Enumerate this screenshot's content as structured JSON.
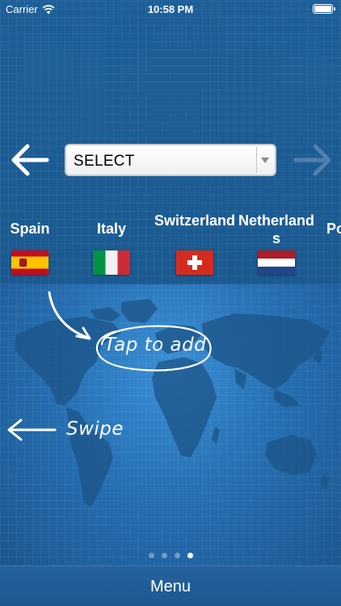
{
  "status_bar": {
    "carrier": "Carrier",
    "time": "10:58 PM"
  },
  "selector": {
    "value": "SELECT"
  },
  "countries": [
    {
      "name": "Spain",
      "flag": "spain-flag"
    },
    {
      "name": "Italy",
      "flag": "italy-flag"
    },
    {
      "name": "Switzerland",
      "flag": "switzerland-flag"
    },
    {
      "name": "Netherlands",
      "flag": "netherlands-flag"
    },
    {
      "name": "Po",
      "flag": ""
    }
  ],
  "hints": {
    "tap": "Tap to add",
    "swipe": "Swipe"
  },
  "pager": {
    "total": 4,
    "active_index": 3
  },
  "menu": {
    "label": "Menu"
  },
  "colors": {
    "background": "#1b5c93",
    "accent": "#ffffff"
  }
}
